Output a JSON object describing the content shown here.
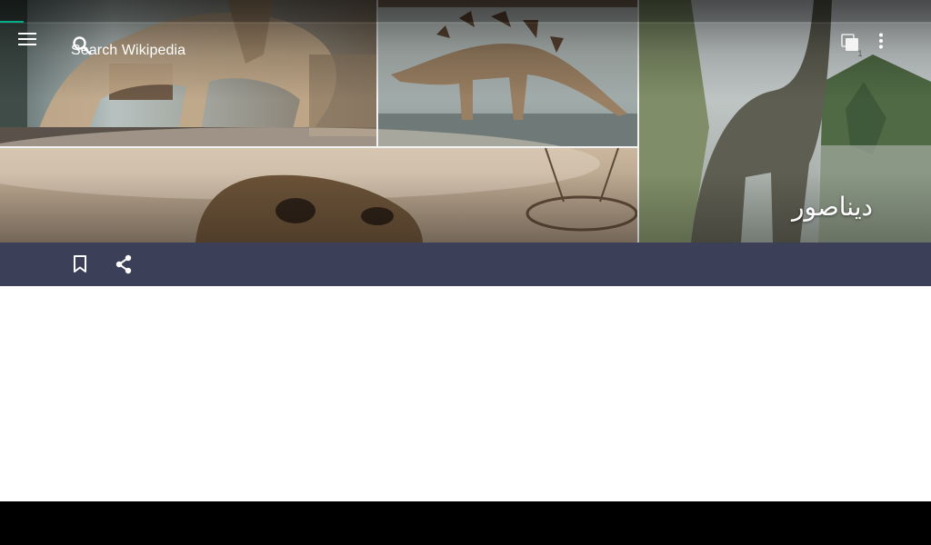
{
  "toolbar": {
    "menu_icon": "hamburger-menu-icon",
    "search_icon": "search-icon",
    "search_placeholder": "Search Wikipedia",
    "tabs_icon": "tabs-icon",
    "tab_count": "1",
    "overflow_icon": "more-vert-icon"
  },
  "article": {
    "title": "ديناصور",
    "lead_image": "dinosaur-collage"
  },
  "action_bar": {
    "bookmark_icon": "bookmark-icon",
    "share_icon": "share-icon"
  },
  "colors": {
    "accent": "#00af89",
    "action_bar": "#3b3f57",
    "nav_bar": "#000000",
    "background": "#ffffff"
  }
}
